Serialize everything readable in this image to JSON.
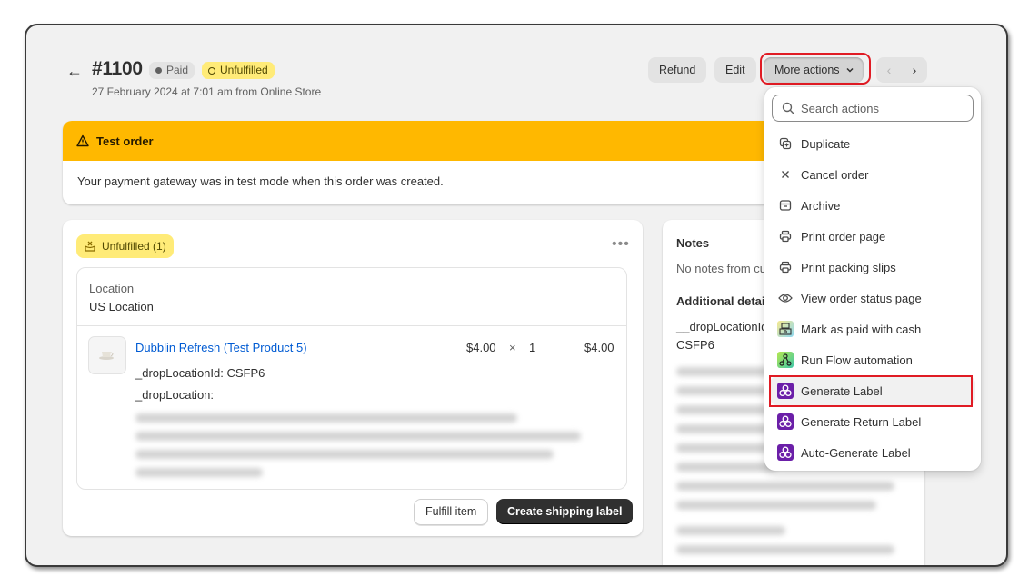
{
  "header": {
    "back_icon": "arrow-left-icon",
    "order_number": "#1100",
    "payment_status": "Paid",
    "fulfillment_status": "Unfulfilled",
    "subtitle": "27 February 2024 at 7:01 am from Online Store",
    "actions": {
      "refund": "Refund",
      "edit": "Edit",
      "more_actions": "More actions",
      "prev": "‹",
      "next": "›"
    }
  },
  "banner": {
    "title": "Test order",
    "message": "Your payment gateway was in test mode when this order was created."
  },
  "fulfillment": {
    "status_label": "Unfulfilled (1)",
    "more_icon": "•••",
    "location_label": "Location",
    "location_value": "US Location",
    "item": {
      "name": "Dubblin Refresh (Test Product 5)",
      "unit_price": "$4.00",
      "times": "×",
      "quantity": "1",
      "total": "$4.00",
      "prop1": "_dropLocationId: CSFP6",
      "prop2": "_dropLocation:"
    },
    "buttons": {
      "fulfill": "Fulfill item",
      "create_label": "Create shipping label"
    }
  },
  "notes": {
    "title": "Notes",
    "text": "No notes from customer",
    "additional_title": "Additional details",
    "additional_key": "__dropLocationId",
    "additional_value": "CSFP6"
  },
  "menu": {
    "search_placeholder": "Search actions",
    "items": [
      {
        "label": "Duplicate",
        "icon": "duplicate-icon"
      },
      {
        "label": "Cancel order",
        "icon": "x-icon"
      },
      {
        "label": "Archive",
        "icon": "archive-icon"
      },
      {
        "label": "Print order page",
        "icon": "printer-icon"
      },
      {
        "label": "Print packing slips",
        "icon": "printer-icon"
      },
      {
        "label": "View order status page",
        "icon": "eye-icon"
      },
      {
        "label": "Mark as paid with cash",
        "icon": "cash-app-icon"
      },
      {
        "label": "Run Flow automation",
        "icon": "flow-app-icon"
      },
      {
        "label": "Generate Label",
        "icon": "label-app-icon"
      },
      {
        "label": "Generate Return Label",
        "icon": "label-app-icon"
      },
      {
        "label": "Auto-Generate Label",
        "icon": "label-app-icon"
      }
    ],
    "highlighted": "Generate Label"
  },
  "colors": {
    "banner": "#ffb800",
    "unfulfilled_badge": "#ffeb78",
    "link": "#005bd3",
    "highlight_outline": "#e01b24",
    "label_app": "#6b1fa8"
  }
}
